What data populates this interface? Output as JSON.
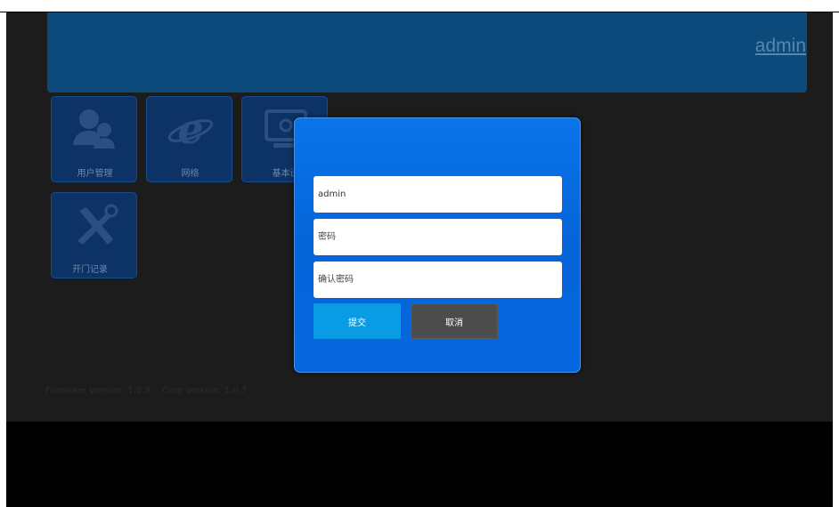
{
  "header": {
    "user_link": "admin"
  },
  "tiles": [
    {
      "label": "用户管理",
      "icon": "users-icon"
    },
    {
      "label": "网络",
      "icon": "internet-explorer-icon"
    },
    {
      "label": "基本设",
      "icon": "monitor-settings-icon"
    },
    {
      "label": "开门记录",
      "icon": "tools-icon"
    }
  ],
  "footer": {
    "firmware": "Firmware Version: 1.2.3",
    "core": "Core Version: 1.0.7"
  },
  "dialog": {
    "username_value": "admin",
    "password_placeholder": "密码",
    "confirm_placeholder": "确认密码",
    "submit_label": "提交",
    "cancel_label": "取消"
  },
  "colors": {
    "dialog": "#0668dd",
    "submit_button": "#0a9be5",
    "cancel_button": "#4c4c4c",
    "tile": "#0d3366",
    "header": "#0c4a7c"
  }
}
